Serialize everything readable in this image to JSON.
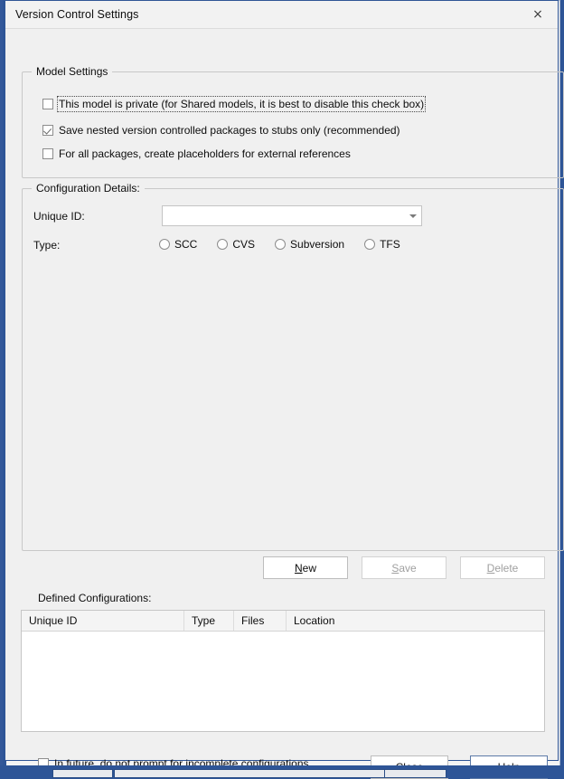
{
  "window": {
    "title": "Version Control Settings",
    "close_icon": "close-icon",
    "close_glyph": "×"
  },
  "model_settings": {
    "legend": "Model Settings",
    "checkboxes": [
      {
        "label": "This model is private (for Shared models, it is best to disable this check box)",
        "checked": false,
        "focused": true
      },
      {
        "label": "Save nested version controlled packages to stubs only (recommended)",
        "checked": true,
        "focused": false
      },
      {
        "label": "For all packages, create placeholders for external references",
        "checked": false,
        "focused": false
      }
    ]
  },
  "configuration_details": {
    "legend": "Configuration Details:",
    "unique_id": {
      "label": "Unique ID:",
      "value": "",
      "placeholder": "",
      "dropdown_icon": "chevron-down-icon"
    },
    "type": {
      "label": "Type:",
      "options": [
        {
          "label": "SCC",
          "selected": false
        },
        {
          "label": "CVS",
          "selected": false
        },
        {
          "label": "Subversion",
          "selected": false
        },
        {
          "label": "TFS",
          "selected": false
        }
      ]
    }
  },
  "actions": {
    "new": {
      "label": "New",
      "mnemonic": "N",
      "enabled": true
    },
    "save": {
      "label": "Save",
      "mnemonic": "S",
      "enabled": false
    },
    "delete": {
      "label": "Delete",
      "mnemonic": "D",
      "enabled": false
    }
  },
  "defined_configurations": {
    "label": "Defined Configurations:",
    "columns": [
      "Unique ID",
      "Type",
      "Files",
      "Location"
    ],
    "rows": []
  },
  "footer": {
    "checkbox": {
      "label": "In future, do not prompt for incomplete configurations",
      "checked": false
    },
    "close": {
      "label": "Close",
      "mnemonic": "o",
      "is_default": false
    },
    "help": {
      "label": "Help",
      "mnemonic": "H",
      "is_default": true
    }
  },
  "colors": {
    "desktop": "#2e5597",
    "dialog_bg": "#f0f0f0",
    "dialog_border": "#2f5596",
    "default_button_border": "#5c7aa8",
    "disabled_text": "#a0a0a0"
  }
}
